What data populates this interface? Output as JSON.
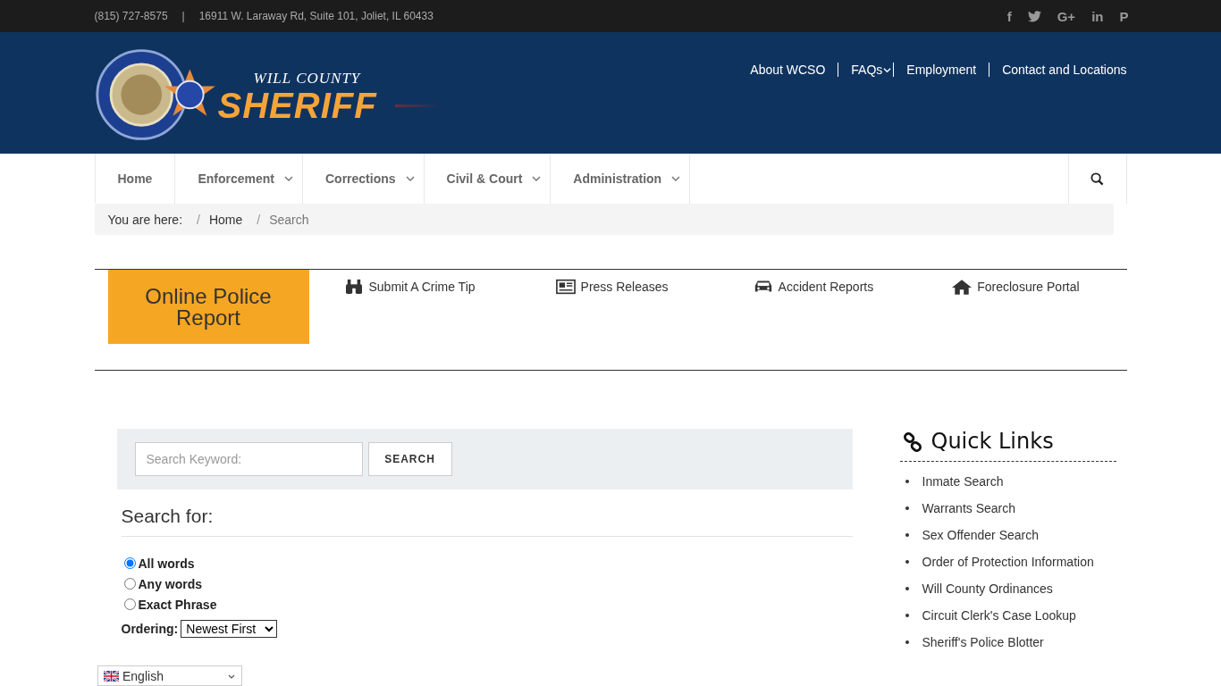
{
  "top_bar": {
    "phone": "(815) 727-8575",
    "separator": "|",
    "address": "16911 W. Laraway Rd, Suite 101, Joliet, IL 60433",
    "social": [
      {
        "kind": "facebook",
        "glyph": "f"
      },
      {
        "kind": "twitter"
      },
      {
        "kind": "google-plus",
        "glyph": "G+"
      },
      {
        "kind": "linkedin",
        "glyph": "in"
      },
      {
        "kind": "pinterest",
        "glyph": "P"
      }
    ]
  },
  "header": {
    "logo": {
      "line_1": "WILL COUNTY",
      "line_2": "SHERIFF"
    },
    "links": [
      {
        "label": "About WCSO",
        "dropdown": false
      },
      {
        "label": "FAQs",
        "dropdown": true
      },
      {
        "label": "Employment",
        "dropdown": false
      },
      {
        "label": "Contact and Locations",
        "dropdown": false
      }
    ]
  },
  "main_nav": [
    {
      "label": "Home",
      "dropdown": false
    },
    {
      "label": "Enforcement",
      "dropdown": true
    },
    {
      "label": "Corrections",
      "dropdown": true
    },
    {
      "label": "Civil & Court",
      "dropdown": true
    },
    {
      "label": "Administration",
      "dropdown": true
    }
  ],
  "breadcrumb": {
    "prefix": "You are here:",
    "items": [
      {
        "separator": "/",
        "label": "Home",
        "current": false
      },
      {
        "separator": "/",
        "label": "Search",
        "current": true
      }
    ]
  },
  "quick_strip": {
    "featured": "Online Police Report",
    "links": [
      {
        "kind": "binoculars",
        "label": "Submit A Crime Tip"
      },
      {
        "kind": "newspaper",
        "label": "Press Releases"
      },
      {
        "kind": "car",
        "label": "Accident Reports"
      },
      {
        "kind": "home",
        "label": "Foreclosure Portal"
      }
    ]
  },
  "search": {
    "placeholder": "Search Keyword:",
    "button": "SEARCH",
    "heading": "Search for:",
    "options": [
      {
        "label": "All words",
        "selected": true
      },
      {
        "label": "Any words",
        "selected": false
      },
      {
        "label": "Exact Phrase",
        "selected": false
      }
    ],
    "ordering_label": "Ordering:",
    "ordering_value": "Newest First"
  },
  "quick_links": {
    "title": "Quick Links",
    "items": [
      "Inmate Search",
      "Warrants Search",
      "Sex Offender Search",
      "Order of Protection Information",
      "Will County Ordinances",
      "Circuit Clerk's Case Lookup",
      "Sheriff's Police Blotter"
    ]
  },
  "language": {
    "value": "English"
  }
}
